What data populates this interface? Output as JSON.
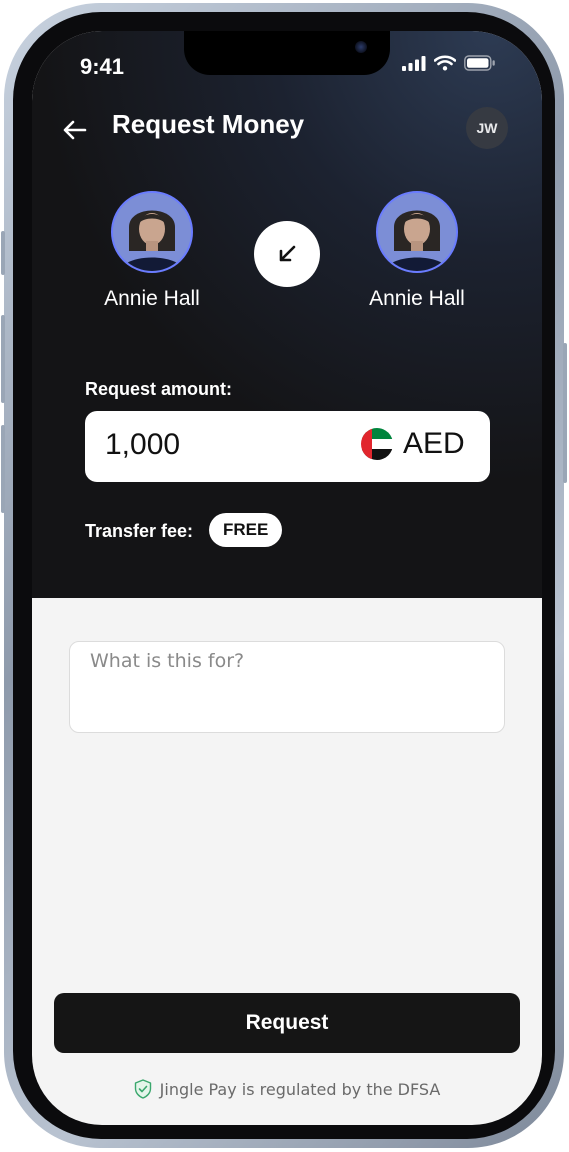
{
  "status_bar": {
    "time": "9:41"
  },
  "header": {
    "title": "Request Money",
    "user_initials": "JW"
  },
  "parties": {
    "from": {
      "name": "Annie Hall"
    },
    "to": {
      "name": "Annie Hall"
    }
  },
  "amount": {
    "label": "Request amount:",
    "value": "1,000",
    "currency": "AED",
    "currency_flag": "uae-flag-icon"
  },
  "fee": {
    "label": "Transfer fee:",
    "value": "FREE"
  },
  "note": {
    "placeholder": "What is this for?"
  },
  "actions": {
    "request_label": "Request"
  },
  "footer": {
    "text": "Jingle Pay is regulated by the DFSA"
  },
  "colors": {
    "header_bg": "#141416",
    "accent_ring": "#6a7cff",
    "button_bg": "#151515",
    "screen_bg": "#f4f4f4",
    "shield": "#3aa76d"
  }
}
